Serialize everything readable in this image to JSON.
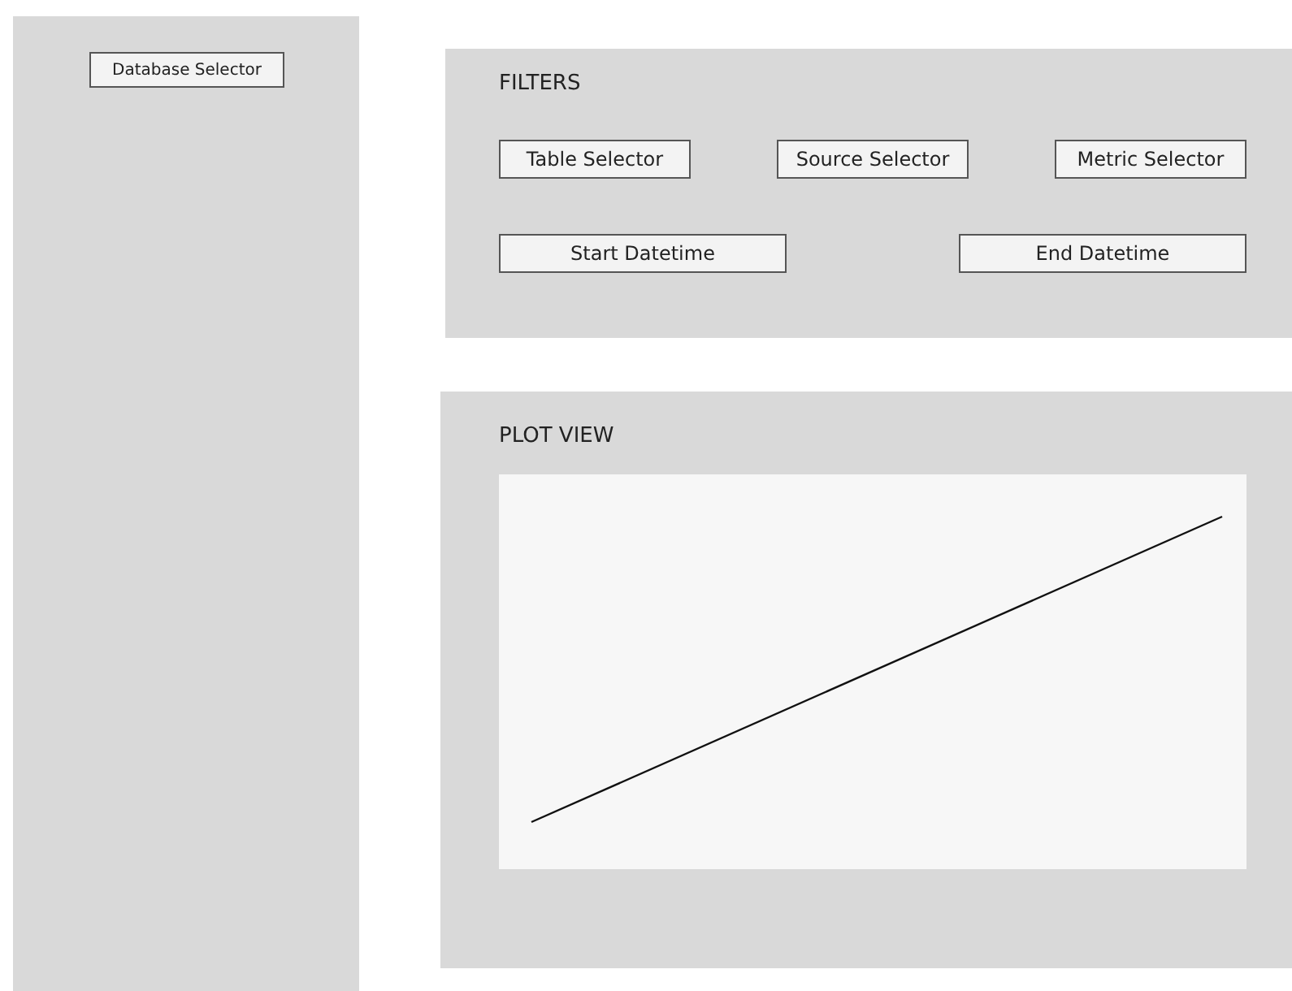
{
  "sidebar": {
    "database_selector": "Database Selector"
  },
  "filters": {
    "title": "FILTERS",
    "selectors": [
      "Table Selector",
      "Source Selector",
      "Metric Selector"
    ],
    "datetimes": [
      "Start Datetime",
      "End Datetime"
    ]
  },
  "plot": {
    "title": "PLOT VIEW"
  }
}
